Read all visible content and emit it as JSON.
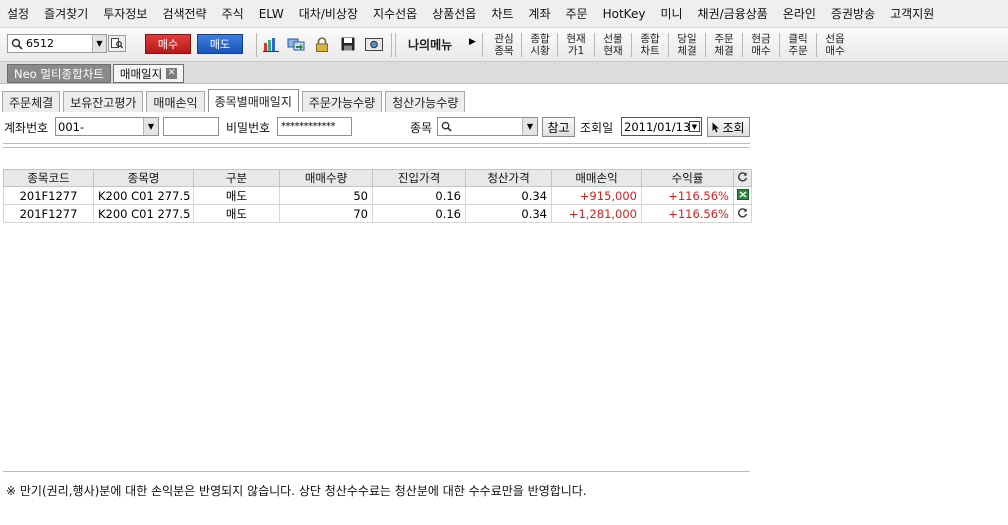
{
  "menu": [
    "설정",
    "즐겨찾기",
    "투자정보",
    "검색전략",
    "주식",
    "ELW",
    "대차/비상장",
    "지수선옵",
    "상품선옵",
    "차트",
    "계좌",
    "주문",
    "HotKey",
    "미니",
    "채권/금융상품",
    "온라인",
    "증권방송",
    "고객지원"
  ],
  "toolbar": {
    "code": "6512",
    "buy_label": "매수",
    "sell_label": "매도",
    "mymenu_label": "나의메뉴",
    "quick": [
      [
        "관심",
        "종목"
      ],
      [
        "종합",
        "시황"
      ],
      [
        "현재",
        "가1"
      ],
      [
        "선물",
        "현재"
      ],
      [
        "종합",
        "차트"
      ],
      [
        "당일",
        "체결"
      ],
      [
        "주문",
        "체결"
      ],
      [
        "현금",
        "매수"
      ],
      [
        "클릭",
        "주문"
      ],
      [
        "선옵",
        "매수"
      ]
    ]
  },
  "doc_tabs": [
    "Neo 멀티종합차트",
    "매매일지"
  ],
  "page_tabs": [
    "주문체결",
    "보유잔고평가",
    "매매손익",
    "종목별매매일지",
    "주문가능수량",
    "청산가능수량"
  ],
  "active_page_tab": 3,
  "form": {
    "account_label": "계좌번호",
    "account_value": "001-",
    "password_label": "비밀번호",
    "password_value": "************",
    "symbol_label": "종목",
    "ref_button": "참고",
    "date_label": "조회일",
    "date_value": "2011/01/13",
    "query_button": "조회"
  },
  "table": {
    "headers": [
      "종목코드",
      "종목명",
      "구분",
      "매매수량",
      "진입가격",
      "청산가격",
      "매매손익",
      "수익률"
    ],
    "rows": [
      [
        "201F1277",
        "K200 C01 277.5",
        "매도",
        "50",
        "0.16",
        "0.34",
        "+915,000",
        "+116.56%"
      ],
      [
        "201F1277",
        "K200 C01 277.5",
        "매도",
        "70",
        "0.16",
        "0.34",
        "+1,281,000",
        "+116.56%"
      ]
    ]
  },
  "colors": {
    "positive": "#d71e1e",
    "buy": "#c62222",
    "sell": "#2266cc"
  },
  "footer_note": "※ 만기(권리,행사)분에 대한 손익분은 반영되지 않습니다.  상단 청산수수료는 청산분에 대한 수수료만을 반영합니다."
}
